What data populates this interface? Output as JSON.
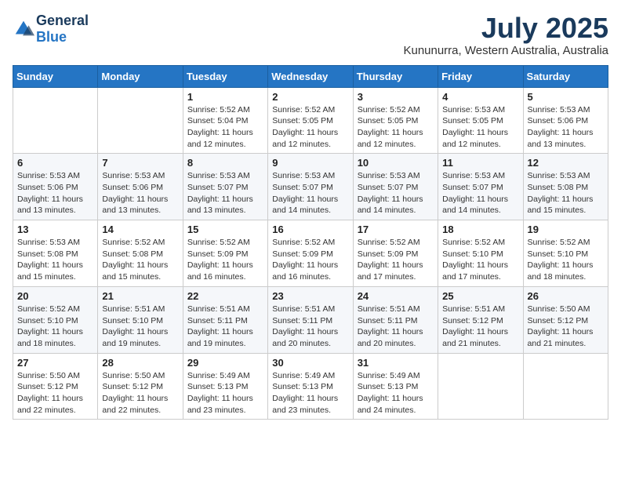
{
  "header": {
    "logo_general": "General",
    "logo_blue": "Blue",
    "month": "July 2025",
    "location": "Kununurra, Western Australia, Australia"
  },
  "weekdays": [
    "Sunday",
    "Monday",
    "Tuesday",
    "Wednesday",
    "Thursday",
    "Friday",
    "Saturday"
  ],
  "weeks": [
    [
      {
        "day": null,
        "info": null
      },
      {
        "day": null,
        "info": null
      },
      {
        "day": "1",
        "info": "Sunrise: 5:52 AM\nSunset: 5:04 PM\nDaylight: 11 hours and 12 minutes."
      },
      {
        "day": "2",
        "info": "Sunrise: 5:52 AM\nSunset: 5:05 PM\nDaylight: 11 hours and 12 minutes."
      },
      {
        "day": "3",
        "info": "Sunrise: 5:52 AM\nSunset: 5:05 PM\nDaylight: 11 hours and 12 minutes."
      },
      {
        "day": "4",
        "info": "Sunrise: 5:53 AM\nSunset: 5:05 PM\nDaylight: 11 hours and 12 minutes."
      },
      {
        "day": "5",
        "info": "Sunrise: 5:53 AM\nSunset: 5:06 PM\nDaylight: 11 hours and 13 minutes."
      }
    ],
    [
      {
        "day": "6",
        "info": "Sunrise: 5:53 AM\nSunset: 5:06 PM\nDaylight: 11 hours and 13 minutes."
      },
      {
        "day": "7",
        "info": "Sunrise: 5:53 AM\nSunset: 5:06 PM\nDaylight: 11 hours and 13 minutes."
      },
      {
        "day": "8",
        "info": "Sunrise: 5:53 AM\nSunset: 5:07 PM\nDaylight: 11 hours and 13 minutes."
      },
      {
        "day": "9",
        "info": "Sunrise: 5:53 AM\nSunset: 5:07 PM\nDaylight: 11 hours and 14 minutes."
      },
      {
        "day": "10",
        "info": "Sunrise: 5:53 AM\nSunset: 5:07 PM\nDaylight: 11 hours and 14 minutes."
      },
      {
        "day": "11",
        "info": "Sunrise: 5:53 AM\nSunset: 5:07 PM\nDaylight: 11 hours and 14 minutes."
      },
      {
        "day": "12",
        "info": "Sunrise: 5:53 AM\nSunset: 5:08 PM\nDaylight: 11 hours and 15 minutes."
      }
    ],
    [
      {
        "day": "13",
        "info": "Sunrise: 5:53 AM\nSunset: 5:08 PM\nDaylight: 11 hours and 15 minutes."
      },
      {
        "day": "14",
        "info": "Sunrise: 5:52 AM\nSunset: 5:08 PM\nDaylight: 11 hours and 15 minutes."
      },
      {
        "day": "15",
        "info": "Sunrise: 5:52 AM\nSunset: 5:09 PM\nDaylight: 11 hours and 16 minutes."
      },
      {
        "day": "16",
        "info": "Sunrise: 5:52 AM\nSunset: 5:09 PM\nDaylight: 11 hours and 16 minutes."
      },
      {
        "day": "17",
        "info": "Sunrise: 5:52 AM\nSunset: 5:09 PM\nDaylight: 11 hours and 17 minutes."
      },
      {
        "day": "18",
        "info": "Sunrise: 5:52 AM\nSunset: 5:10 PM\nDaylight: 11 hours and 17 minutes."
      },
      {
        "day": "19",
        "info": "Sunrise: 5:52 AM\nSunset: 5:10 PM\nDaylight: 11 hours and 18 minutes."
      }
    ],
    [
      {
        "day": "20",
        "info": "Sunrise: 5:52 AM\nSunset: 5:10 PM\nDaylight: 11 hours and 18 minutes."
      },
      {
        "day": "21",
        "info": "Sunrise: 5:51 AM\nSunset: 5:10 PM\nDaylight: 11 hours and 19 minutes."
      },
      {
        "day": "22",
        "info": "Sunrise: 5:51 AM\nSunset: 5:11 PM\nDaylight: 11 hours and 19 minutes."
      },
      {
        "day": "23",
        "info": "Sunrise: 5:51 AM\nSunset: 5:11 PM\nDaylight: 11 hours and 20 minutes."
      },
      {
        "day": "24",
        "info": "Sunrise: 5:51 AM\nSunset: 5:11 PM\nDaylight: 11 hours and 20 minutes."
      },
      {
        "day": "25",
        "info": "Sunrise: 5:51 AM\nSunset: 5:12 PM\nDaylight: 11 hours and 21 minutes."
      },
      {
        "day": "26",
        "info": "Sunrise: 5:50 AM\nSunset: 5:12 PM\nDaylight: 11 hours and 21 minutes."
      }
    ],
    [
      {
        "day": "27",
        "info": "Sunrise: 5:50 AM\nSunset: 5:12 PM\nDaylight: 11 hours and 22 minutes."
      },
      {
        "day": "28",
        "info": "Sunrise: 5:50 AM\nSunset: 5:12 PM\nDaylight: 11 hours and 22 minutes."
      },
      {
        "day": "29",
        "info": "Sunrise: 5:49 AM\nSunset: 5:13 PM\nDaylight: 11 hours and 23 minutes."
      },
      {
        "day": "30",
        "info": "Sunrise: 5:49 AM\nSunset: 5:13 PM\nDaylight: 11 hours and 23 minutes."
      },
      {
        "day": "31",
        "info": "Sunrise: 5:49 AM\nSunset: 5:13 PM\nDaylight: 11 hours and 24 minutes."
      },
      {
        "day": null,
        "info": null
      },
      {
        "day": null,
        "info": null
      }
    ]
  ]
}
